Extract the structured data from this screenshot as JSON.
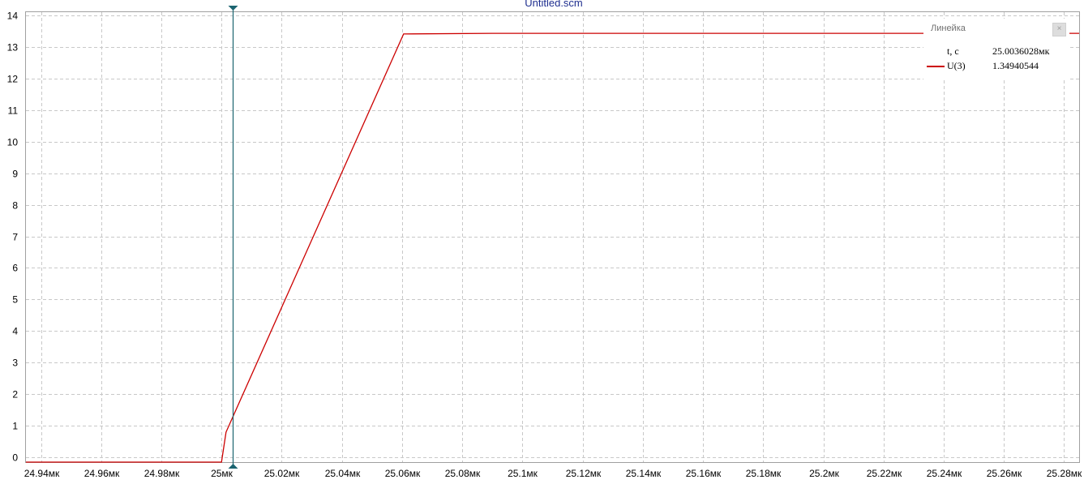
{
  "chart_data": {
    "type": "line",
    "title": "Untitled.scm",
    "xlabel": "",
    "ylabel": "",
    "xlim": [
      24.935,
      25.285
    ],
    "ylim": [
      -0.15,
      14.1
    ],
    "x_ticks": [
      24.94,
      24.96,
      24.98,
      25.0,
      25.02,
      25.04,
      25.06,
      25.08,
      25.1,
      25.12,
      25.14,
      25.16,
      25.18,
      25.2,
      25.22,
      25.24,
      25.26,
      25.28
    ],
    "x_tick_labels": [
      "24.94мк",
      "24.96мк",
      "24.98мк",
      "25мк",
      "25.02мк",
      "25.04мк",
      "25.06мк",
      "25.08мк",
      "25.1мк",
      "25.12мк",
      "25.14мк",
      "25.16мк",
      "25.18мк",
      "25.2мк",
      "25.22мк",
      "25.24мк",
      "25.26мк",
      "25.28мк"
    ],
    "y_ticks": [
      0,
      1,
      2,
      3,
      4,
      5,
      6,
      7,
      8,
      9,
      10,
      11,
      12,
      13,
      14
    ],
    "y_tick_labels": [
      "0",
      "1",
      "2",
      "3",
      "4",
      "5",
      "6",
      "7",
      "8",
      "9",
      "10",
      "11",
      "12",
      "13",
      "14"
    ],
    "grid": true,
    "series": [
      {
        "name": "U(3)",
        "color": "#cc0000",
        "x": [
          24.935,
          25.0,
          25.0015,
          25.0605,
          25.09,
          25.285
        ],
        "y": [
          -0.15,
          -0.15,
          0.8,
          13.41,
          13.43,
          13.43
        ]
      }
    ],
    "cursor": {
      "x": 25.0036028,
      "color": "#1b6470"
    }
  },
  "ruler": {
    "title": "Линейка",
    "close_glyph": "×",
    "rows": [
      {
        "label": "t, c",
        "value": "25.0036028мк"
      },
      {
        "label": "U(3)",
        "value": "1.34940544",
        "color": "#cc0000"
      }
    ]
  }
}
